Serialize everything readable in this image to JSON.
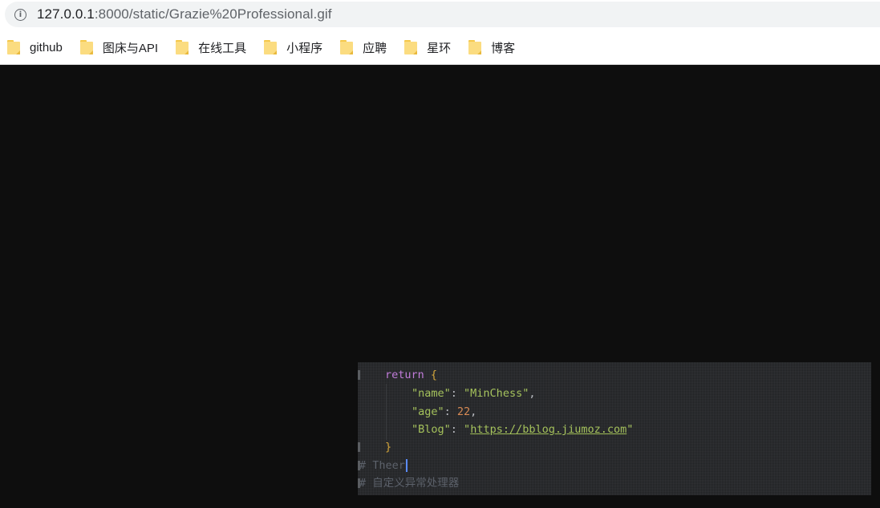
{
  "address_bar": {
    "url_host": "127.0.0.1",
    "url_rest": ":8000/static/Grazie%20Professional.gif",
    "info_icon": "info-circle-icon"
  },
  "bookmarks": [
    {
      "label": "github",
      "icon": "folder-icon"
    },
    {
      "label": "图床与API",
      "icon": "folder-icon"
    },
    {
      "label": "在线工具",
      "icon": "folder-icon"
    },
    {
      "label": "小程序",
      "icon": "folder-icon"
    },
    {
      "label": "应聘",
      "icon": "folder-icon"
    },
    {
      "label": "星环",
      "icon": "folder-icon"
    },
    {
      "label": "博客",
      "icon": "folder-icon"
    }
  ],
  "code": {
    "return_kw": "return",
    "open_brace": "{",
    "name_key": "\"name\"",
    "name_val": "\"MinChess\"",
    "age_key": "\"age\"",
    "age_val": "22",
    "blog_key": "\"Blog\"",
    "blog_quote_open": "\"",
    "blog_url": "https://bblog.jiumoz.com",
    "blog_quote_close": "\"",
    "close_brace": "}",
    "comment_typing": "# Theer",
    "comment_next": "# 自定义异常处理器"
  },
  "colors": {
    "page_bg": "#0e0e0e",
    "editor_bg": "#2a2c2f",
    "keyword": "#c27ddb",
    "string": "#a5c25c",
    "number": "#d98b55",
    "brace": "#d4a63c",
    "comment": "#5b6069",
    "caret": "#5b8cff"
  }
}
